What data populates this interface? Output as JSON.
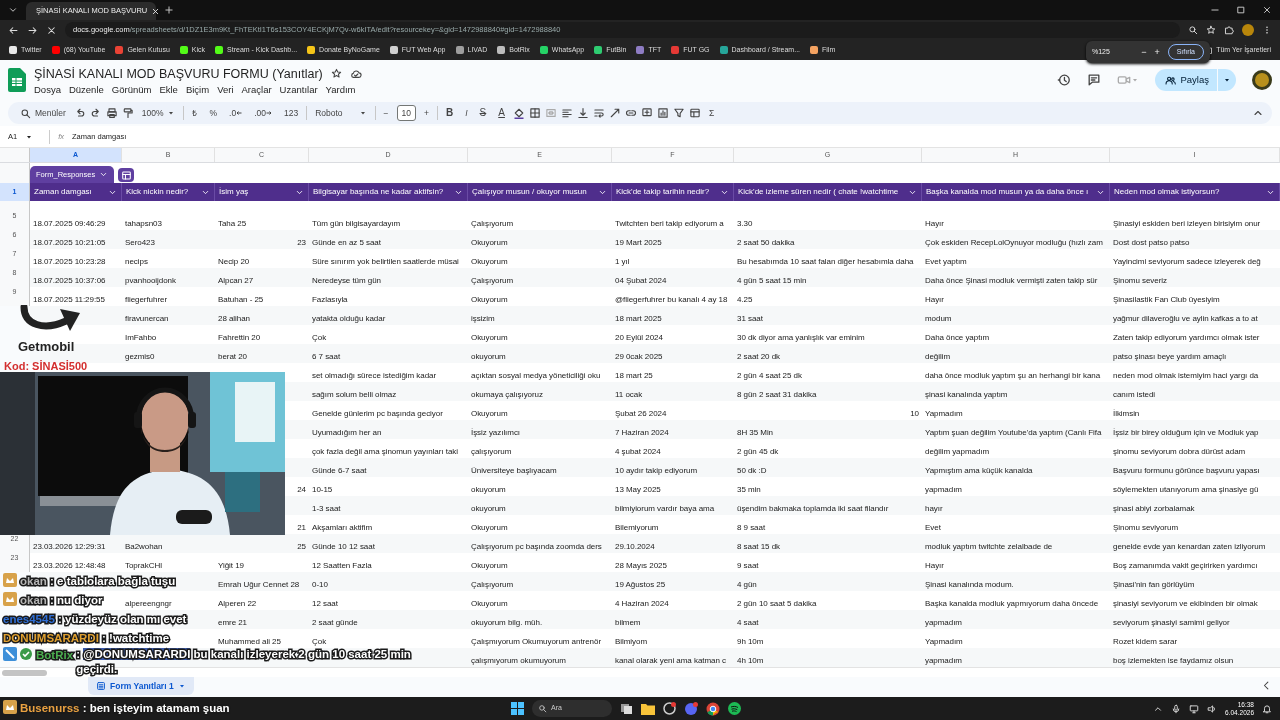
{
  "browser": {
    "tab_title": "ŞİNASİ KANALI MOD BAŞVURU",
    "url_host": "docs.google.com",
    "url_path": "/spreadsheets/d/1DZ1E3m9Kt_FhTEKtI1T6s153COY4ECKjM7Qv-w6kITA/edit?resourcekey=&gid=1472988840#gid=1472988840",
    "bookmarks": [
      {
        "label": "Twitter",
        "color": "#e8e8e8"
      },
      {
        "label": "(68) YouTube",
        "color": "#ff0000"
      },
      {
        "label": "Gelen Kutusu",
        "color": "#ea4335"
      },
      {
        "label": "Kick",
        "color": "#53fc18"
      },
      {
        "label": "Stream - Kick Dashb...",
        "color": "#53fc18"
      },
      {
        "label": "Donate ByNoGame",
        "color": "#f5c518"
      },
      {
        "label": "FUT Web App",
        "color": "#d0d0d0"
      },
      {
        "label": "LIVAD",
        "color": "#9e9e9e"
      },
      {
        "label": "BotRix",
        "color": "#bdbdbd"
      },
      {
        "label": "WhatsApp",
        "color": "#25d366"
      },
      {
        "label": "FutBin",
        "color": "#2ecc71"
      },
      {
        "label": "TFT",
        "color": "#8e7cc3"
      },
      {
        "label": "FUT GG",
        "color": "#e53935"
      },
      {
        "label": "Dashboard / Stream...",
        "color": "#26a69a"
      },
      {
        "label": "Film",
        "color": "#f4a261"
      }
    ],
    "all_bookmarks": "Tüm Yer İşaretleri",
    "zoom": {
      "value": "%125",
      "minus": "−",
      "plus": "+",
      "reset": "Sıfırla"
    }
  },
  "sheets": {
    "title": "ŞİNASİ KANALI MOD BAŞVURU FORMU (Yanıtlar)",
    "menus": [
      "Dosya",
      "Düzenle",
      "Görünüm",
      "Ekle",
      "Biçim",
      "Veri",
      "Araçlar",
      "Uzantılar",
      "Yardım"
    ],
    "share": "Paylaş",
    "toolbar": {
      "search": "Menüler",
      "zoom": "100%",
      "currency": "₺",
      "percent": "%",
      "decrease_decimals": ".0",
      "increase_decimals": ".00",
      "number_format": "123",
      "font": "Roboto",
      "minus": "−",
      "font_size": "10",
      "plus": "+",
      "functions": "Σ",
      "text_format": [
        {
          "label": "B",
          "kind": "bold"
        },
        {
          "label": "I",
          "kind": "italic"
        },
        {
          "label": "S",
          "kind": "strike"
        },
        {
          "label": "A",
          "kind": "color"
        }
      ]
    },
    "name_box": "A1",
    "fx": "fx",
    "formula": "Zaman damgası",
    "columns": [
      {
        "label": "A",
        "selected": true
      },
      {
        "label": "B",
        "selected": false
      },
      {
        "label": "C",
        "selected": false
      },
      {
        "label": "D",
        "selected": false
      },
      {
        "label": "E",
        "selected": false
      },
      {
        "label": "F",
        "selected": false
      },
      {
        "label": "G",
        "selected": false
      },
      {
        "label": "H",
        "selected": false
      },
      {
        "label": "I",
        "selected": false
      }
    ],
    "table_name": "Form_Responses",
    "header_row": "1",
    "headers": [
      "Zaman damgası",
      "Kick nickin nedir?",
      "İsim yaş",
      "Bilgisayar başında ne kadar aktifsin?",
      "Çalışıyor musun / okuyor musun",
      "Kick'de takip tarihin nedir?",
      "Kick'de izleme süren nedir ( chate !watchtime",
      "Başka kanalda mod musun ya da daha önce ı",
      "Neden mod olmak istiyorsun?"
    ],
    "rows": [
      {
        "num": "5",
        "cells": [
          "18.07.2025 09:46:29",
          "tahapsn03",
          "Taha 25",
          "Tüm gün bilgisayardayım",
          "Çalışıyorum",
          "Twitchten beri takip ediyorum a",
          "3.30",
          "Hayır",
          "Şinasiyi eskiden beri izleyen birisiyim onur"
        ]
      },
      {
        "num": "6",
        "cells": [
          "18.07.2025 10:21:05",
          "Sero423",
          {
            "text": "23",
            "numeric": true
          },
          "Günde en az 5 saat",
          "Okuyorum",
          "19 Mart 2025",
          "2 saat 50 dakika",
          "Çok eskiden RecepLolOynuyor modluğu (hızlı zam",
          "Dost dost patso patso"
        ]
      },
      {
        "num": "7",
        "cells": [
          "18.07.2025 10:23:28",
          "necips",
          "Necip 20",
          "Süre sınırım yok belirtilen saatlerde müsai",
          "Okuyorum",
          "1 yıl",
          "Bu hesabımda 10 saat falan diğer hesabımla daha",
          "Evet yaptım",
          "Yayincimi seviyorum sadece izleyerek değ"
        ]
      },
      {
        "num": "8",
        "cells": [
          "18.07.2025 10:37:06",
          "pvanhooijdonk",
          "Alpcan 27",
          "Neredeyse tüm gün",
          "Çalışıyorum",
          "04 Şubat 2024",
          "4 gün 5 saat 15 min",
          "Daha önce Şinasi modluk vermişti zaten takip sür",
          "Şinomu severiz"
        ]
      },
      {
        "num": "9",
        "cells": [
          "18.07.2025 11:29:55",
          "fliegerfuhrer",
          "Batuhan - 25",
          "Fazlasıyla",
          "Okuyorum",
          "@fliegerfuhrer bu kanalı 4 ay 18",
          "4.25",
          "Hayır",
          "Şinasilastik Fan Club üyesiyim"
        ]
      },
      {
        "cells": [
          null,
          "firavunercan",
          "28 alihan",
          "yatakta olduğu kadar",
          "işsizim",
          "18 mart 2025",
          "31 saat",
          "modum",
          "yağmur dilaveroğlu ve aylin kafkas a to at"
        ]
      },
      {
        "cells": [
          null,
          "ImFahbo",
          "Fahrettin 20",
          "Çok",
          "Okuyorum",
          "20 Eylül 2024",
          "30 dk diyor ama yanlışlık var eminim",
          "Daha önce yaptım",
          "Zaten takip ediyorum yardımcı olmak ister"
        ]
      },
      {
        "cells": [
          null,
          "gezmis0",
          "berat 20",
          "6 7 saat",
          "okuyorum",
          "29 0cak 2025",
          "2 saat 20 dk",
          "değilim",
          "patso şinası beye yardım amaçlı"
        ]
      },
      {
        "cells": [
          null,
          null,
          null,
          "set olmadığı sürece istediğim kadar",
          "açıktan sosyal medya yöneticiliği oku",
          "18 mart 25",
          "2 gün 4 saat 25 dk",
          "daha önce modluk yaptım şu an herhangi bir kana",
          "neden mod olmak istemiyim haci yargı da"
        ]
      },
      {
        "cells": [
          null,
          null,
          null,
          "sağım solum belli olmaz",
          "okumaya çalışıyoruz",
          "11 ocak",
          "8 gün 2 saat 31 dakika",
          "şinasi kanalında yaptım",
          "canım istedi"
        ]
      },
      {
        "cells": [
          null,
          null,
          null,
          "Genelde günlerim pc başında geciyor",
          "Okuyorum",
          "Şubat 26 2024",
          {
            "text": "10",
            "numeric": true
          },
          "Yapmadım",
          "İlkimsin"
        ]
      },
      {
        "cells": [
          null,
          null,
          null,
          "Uyumadığım her an",
          "İşsiz yazılımcı",
          "7 Haziran 2024",
          "8H 35 Min",
          "Yaptım şuan değilim Youtube'da yaptım (Canlı Fifa",
          "İşsiz bir birey olduğum için ve Modluk yap"
        ]
      },
      {
        "cells": [
          null,
          null,
          null,
          "çok fazla değil ama şinomun yayınları taki",
          "çalışıyorum",
          "4 şubat 2024",
          "2 gün 45 dk",
          "değilim yapmadım",
          "şinomu seviyorum dobra dürüst adam"
        ]
      },
      {
        "cells": [
          null,
          null,
          null,
          "Günde 6-7 saat",
          "Üniversiteye başlıyacam",
          "10 aydır takip ediyorum",
          "50 dk :D",
          "Yapmıştım ama küçük kanalda",
          "Başvuru formunu görünce başvuru yapası"
        ]
      },
      {
        "cells": [
          null,
          null,
          {
            "text": "24",
            "numeric": true
          },
          "10-15",
          "okuyorum",
          "13 May 2025",
          "35 min",
          "yapmadım",
          "söylemekten utanıyorum ama şinasiye gü"
        ]
      },
      {
        "cells": [
          null,
          null,
          null,
          "1-3 saat",
          "okuyorum",
          "bilmiyiorum vardır baya ama",
          "üşendim bakmaka toplamda iki saat filandır",
          "hayır",
          "şinasi abiyi zorbalamak"
        ]
      },
      {
        "cells": [
          null,
          null,
          {
            "text": "21",
            "numeric": true
          },
          "Akşamları aktifim",
          "Okuyorum",
          "Bilemiyorum",
          "8 9 saat",
          "Evet",
          "Şinomu seviyorum"
        ]
      },
      {
        "num": "22",
        "cells": [
          "23.03.2026 12:29:31",
          "Ba2wohan",
          {
            "text": "25",
            "numeric": true
          },
          "Günde 10 12 saat",
          "Çalışıyorum pc başında zoomda ders",
          "29.10.2024",
          "8 saat 15 dk",
          "modluk yaptım twitchte zelalbade de",
          "genelde evde yan kenardan zaten izliyorum"
        ]
      },
      {
        "num": "23",
        "cells": [
          "23.03.2026 12:48:48",
          "ToprakCHl",
          "Yiğit 19",
          "12 Saatten Fazla",
          "Okuyorum",
          "28 Mayıs 2025",
          "9 saat",
          "Hayır",
          "Boş zamanımda vakit geçirirken yardımcı"
        ]
      },
      {
        "cells": [
          null,
          null,
          "Emrah Uğur Cennet 28",
          "0-10",
          "Çalışıyorum",
          "19 Ağustos 25",
          "4 gün",
          "Şinasi kanalında modum.",
          "Şinasi'nin fan görlüyüm"
        ]
      },
      {
        "cells": [
          null,
          "alpereengngr",
          "Alperen 22",
          "12 saat",
          "Okuyorum",
          "4 Haziran 2024",
          "2 gün 10 saat 5 dakika",
          "Başka kanalda modluk yapmıyorum daha öncede",
          "şinasiyi seviyorum ve ekibinden bir olmak"
        ]
      },
      {
        "cells": [
          null,
          null,
          "emre 21",
          "2 saat günde",
          "okuyorum bilg. müh.",
          "bilmem",
          "4 saat",
          "yapmadım",
          "seviyorum şinasiyi samimi geliyor"
        ]
      },
      {
        "cells": [
          null,
          null,
          "Muhammed ali 25",
          "Çok",
          "Çalışmıyorum Okumuyorum antrenör",
          "Bilmiyom",
          "9h 10m",
          "Yapmadım",
          "Rozet kidem sarar"
        ]
      },
      {
        "cells": [
          null,
          null,
          null,
          null,
          "çalışmıyorum okumuyorum",
          "kanal olarak yeni ama katman c",
          "4h 10m",
          "yapmadım",
          "boş izlemekten ise faydamız olsun"
        ]
      }
    ],
    "sheet_tabs": [
      {
        "label": "Form Yanıtları 1",
        "selected": true
      }
    ]
  },
  "overlay": {
    "promo": {
      "brand": "Getmobil",
      "code": "Kod: SİNASİ500"
    },
    "chat": [
      {
        "user": "okan",
        "color": "#b5b5b5",
        "kind": "badge",
        "text": ": e tablolara bağla tuşu"
      },
      {
        "user": "okan",
        "color": "#b5b5b5",
        "kind": "badge",
        "text": ": nu diyor"
      },
      {
        "user": "enes4545",
        "color": "#2f6fd6",
        "kind": "plain",
        "text": ": yüzdeyüz olan mı evet"
      },
      {
        "user": "DONUMSARARDI",
        "color": "#e0a030",
        "kind": "plain",
        "text": ": !watchtime"
      },
      {
        "user": "BotRix",
        "color": "#4caf50",
        "kind": "bot",
        "text": ": **@DONUMSARARDI** bu kanalı izleyerek 2 gün 10 saat 25 min geçirdi."
      }
    ],
    "taskbar_chat": {
      "user": "Busenurss",
      "color": "#e8a040",
      "kind": "badge",
      "text": ": ben işteyim atamam şuan"
    }
  },
  "taskbar": {
    "search": "Ara",
    "time": "16:38",
    "date": "6.04.2026"
  }
}
